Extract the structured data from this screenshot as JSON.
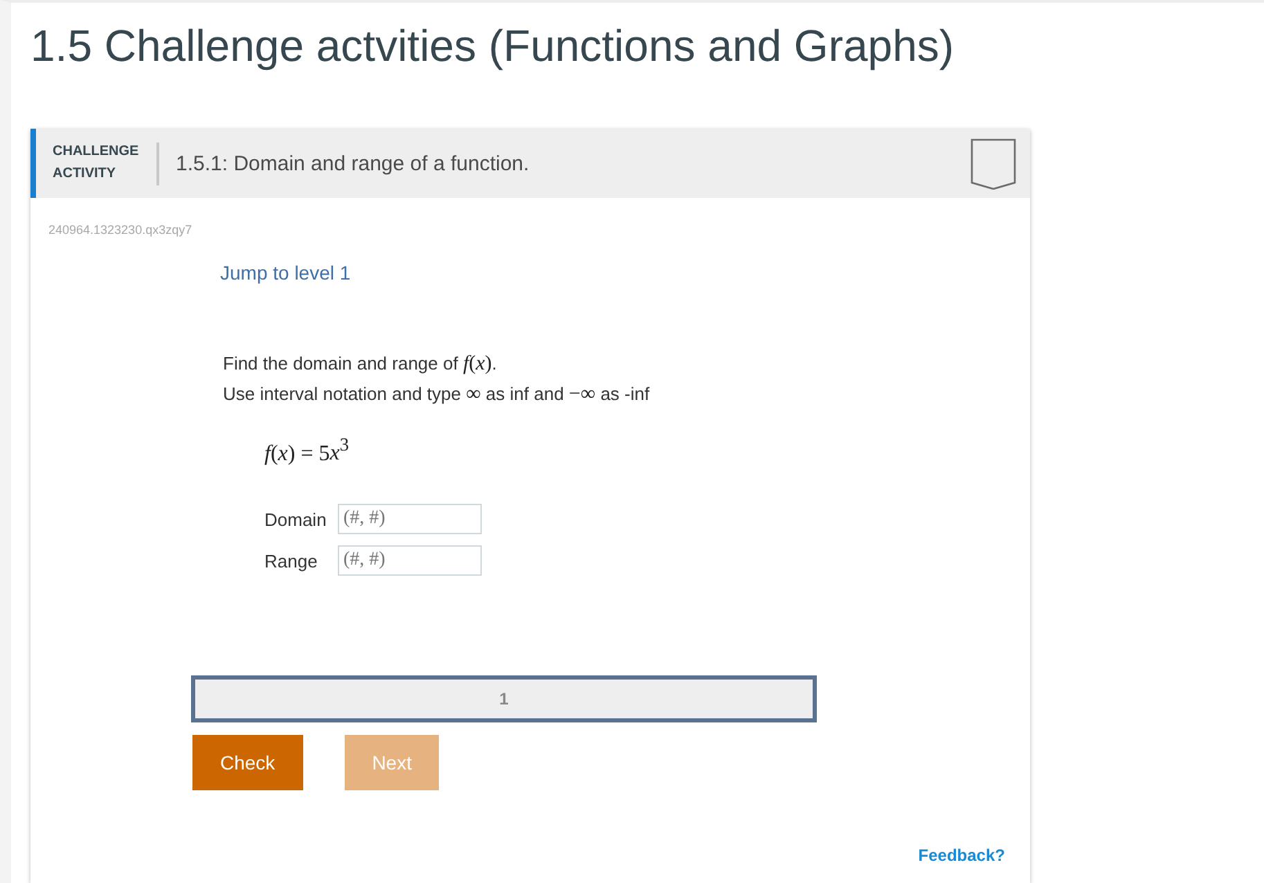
{
  "page": {
    "title": "1.5 Challenge actvities (Functions and Graphs)"
  },
  "activity": {
    "label_lines": [
      "CHALLENGE",
      "ACTIVITY"
    ],
    "title": "1.5.1: Domain and range of a function.",
    "activity_id": "240964.1323230.qx3zqy7",
    "jump_link": "Jump to level 1"
  },
  "instructions": [
    [
      {
        "kind": "text",
        "text": "Find the domain and range of "
      },
      {
        "kind": "math",
        "text": "*f*(*x*)"
      },
      {
        "kind": "text",
        "text": "."
      }
    ],
    [
      {
        "kind": "text",
        "text": "Use interval notation and type "
      },
      {
        "kind": "math",
        "text": "∞"
      },
      {
        "kind": "text",
        "text": " as inf and "
      },
      {
        "kind": "math",
        "text": "−∞"
      },
      {
        "kind": "text",
        "text": " as -inf"
      }
    ]
  ],
  "formula": [
    {
      "kind": "math",
      "text": "*f*(*x*) = 5"
    },
    {
      "kind": "math",
      "text": "*x*$^{3}$"
    }
  ],
  "fields": [
    {
      "label": "Domain",
      "placeholder": "(#, #)"
    },
    {
      "label": "Range",
      "placeholder": "(#, #)"
    }
  ],
  "levels": [
    {
      "label": "1",
      "selected": true
    }
  ],
  "buttons": [
    {
      "label": "Check",
      "disabled": false
    },
    {
      "label": "Next",
      "disabled": true
    }
  ],
  "feedback_link": "Feedback?"
}
